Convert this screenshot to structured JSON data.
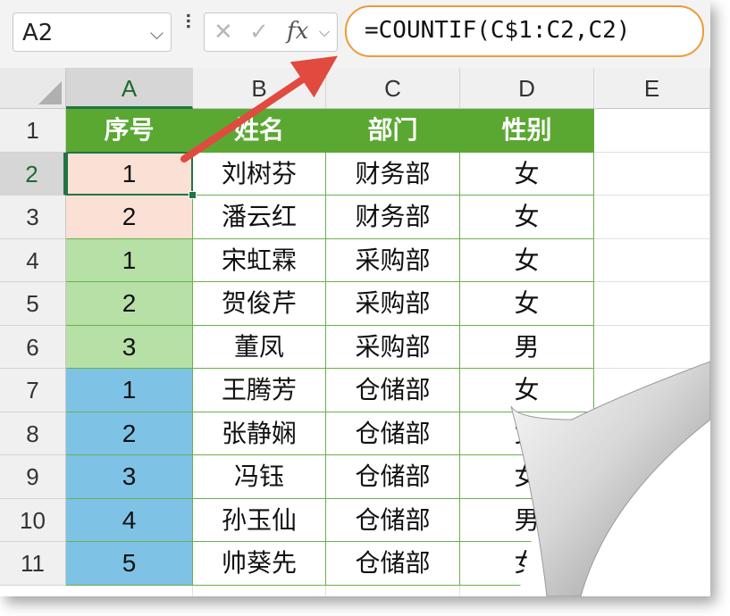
{
  "name_box": {
    "value": "A2"
  },
  "formula": {
    "value": "=COUNTIF(C$1:C2,C2)",
    "fx_label": "fx"
  },
  "columns": [
    "A",
    "B",
    "C",
    "D",
    "E"
  ],
  "row_numbers": [
    "1",
    "2",
    "3",
    "4",
    "5",
    "6",
    "7",
    "8",
    "9",
    "10",
    "11"
  ],
  "table": {
    "headers": [
      "序号",
      "姓名",
      "部门",
      "性别"
    ],
    "rows": [
      [
        "1",
        "刘树芬",
        "财务部",
        "女"
      ],
      [
        "2",
        "潘云红",
        "财务部",
        "女"
      ],
      [
        "1",
        "宋虹霖",
        "采购部",
        "女"
      ],
      [
        "2",
        "贺俊芹",
        "采购部",
        "女"
      ],
      [
        "3",
        "董凤",
        "采购部",
        "男"
      ],
      [
        "1",
        "王腾芳",
        "仓储部",
        "女"
      ],
      [
        "2",
        "张静娴",
        "仓储部",
        "女"
      ],
      [
        "3",
        "冯钰",
        "仓储部",
        "女"
      ],
      [
        "4",
        "孙玉仙",
        "仓储部",
        "男"
      ],
      [
        "5",
        "帅葵先",
        "仓储部",
        "女"
      ]
    ]
  },
  "colors": {
    "header_fill": "#5aa832",
    "finance_fill": "#fbe0d6",
    "purchase_fill": "#b6e0a6",
    "warehouse_fill": "#7ec3e6",
    "highlight_outline": "#ef9a3a",
    "arrow": "#e04a3f"
  },
  "icons": {
    "cancel": "close-icon",
    "enter": "check-icon",
    "function": "fx-icon",
    "dropdown": "chevron-down-icon"
  }
}
